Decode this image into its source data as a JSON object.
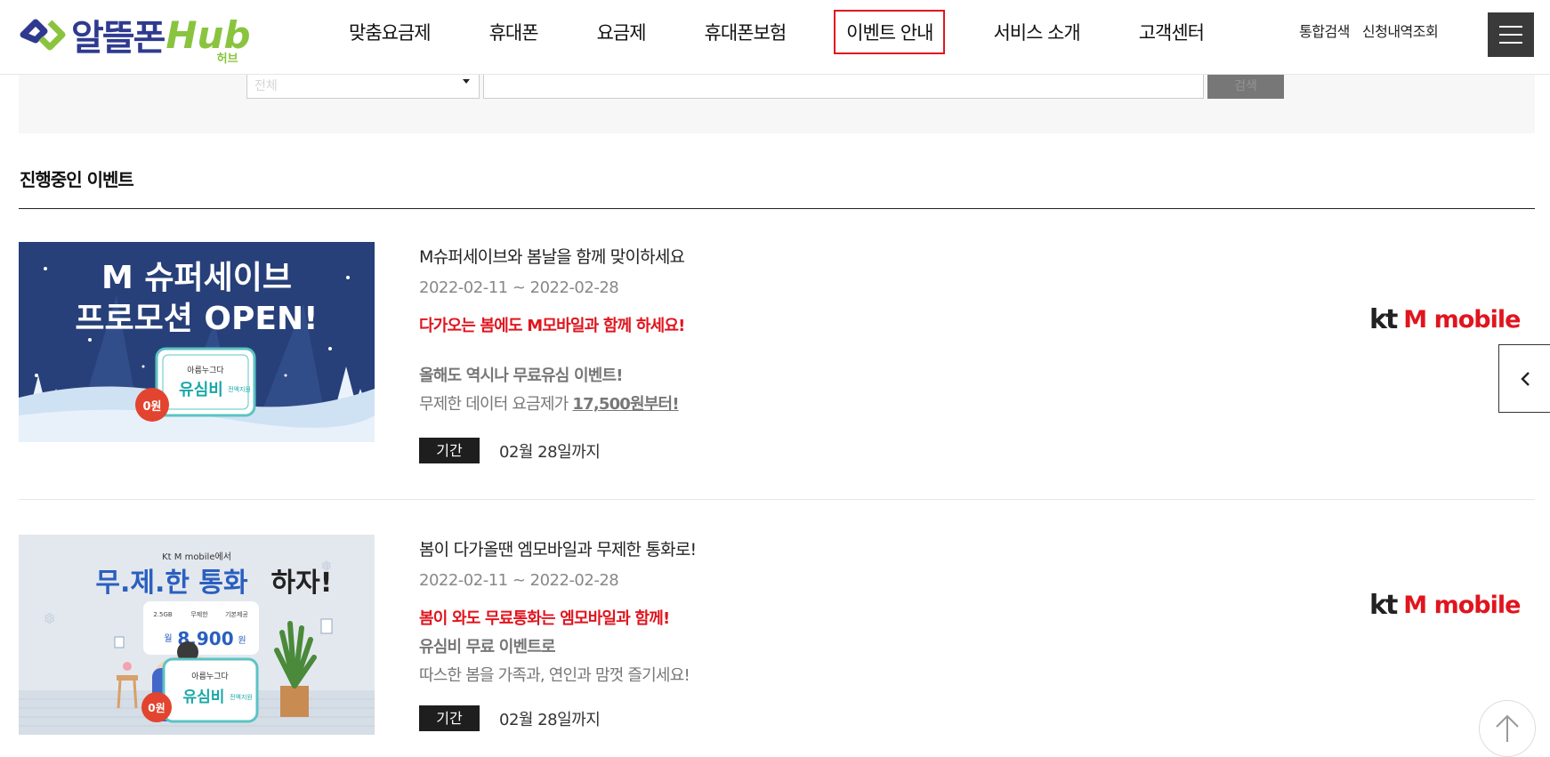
{
  "header": {
    "logo_text": "알뜰폰",
    "logo_hub": "Hub",
    "logo_hub_sub": "허브",
    "nav": [
      {
        "label": "맞춤요금제",
        "active": false
      },
      {
        "label": "휴대폰",
        "active": false
      },
      {
        "label": "요금제",
        "active": false
      },
      {
        "label": "휴대폰보험",
        "active": false
      },
      {
        "label": "이벤트 안내",
        "active": true
      },
      {
        "label": "서비스 소개",
        "active": false
      },
      {
        "label": "고객센터",
        "active": false
      }
    ],
    "top_links": [
      "통합검색",
      "신청내역조회"
    ],
    "menu_icon": "hamburger-icon"
  },
  "search": {
    "select_value": "전체",
    "input_value": "",
    "button_label": "검색"
  },
  "section": {
    "title": "진행중인 이벤트"
  },
  "events": [
    {
      "thumb": {
        "line1": "M 슈퍼세이브",
        "line2": "프로모션 OPEN!",
        "badge_brand": "아름누그다",
        "badge_text": "유심비",
        "badge_small": "전액지원",
        "price_badge": "0원"
      },
      "title": "M슈퍼세이브와 봄날을 함께 맞이하세요",
      "date": "2022-02-11 ~ 2022-02-28",
      "highlight": "다가오는 봄에도 M모바일과 함께 하세요!",
      "desc_bold": "올해도 역시나 무료유심 이벤트!",
      "desc_prefix": "무제한 데이터 요금제가 ",
      "desc_emph": "17,500원부터!",
      "period_label": "기간",
      "period_value": "02월 28일까지",
      "brand_kt": "kt",
      "brand_name": "M mobile"
    },
    {
      "thumb": {
        "top": "Kt M mobile에서",
        "headline_a": "무.제.한 통화",
        "headline_b": "하자!",
        "chip1": "2.5GB",
        "chip2": "무제한",
        "chip3": "기본제공",
        "price_label": "월",
        "price": "8,900",
        "price_unit": "원",
        "badge_brand": "아름누그다",
        "badge_text": "유심비",
        "badge_small": "전액지원",
        "price_badge": "0원"
      },
      "title": "봄이 다가올땐 엠모바일과 무제한 통화로!",
      "date": "2022-02-11 ~ 2022-02-28",
      "highlight": "봄이 와도 무료통화는 엠모바일과 함께!",
      "desc_bold": "유심비 무료 이벤트로",
      "desc_plain": "따스한 봄을 가족과, 연인과 맘껏 즐기세요!",
      "period_label": "기간",
      "period_value": "02월 28일까지",
      "brand_kt": "kt",
      "brand_name": "M mobile"
    }
  ],
  "colors": {
    "accent_red": "#e0151e",
    "logo_blue": "#2f3a8f",
    "logo_green": "#8ac43f",
    "banner1_bg": "#27407a",
    "banner2_bg": "#e3e8ee"
  }
}
